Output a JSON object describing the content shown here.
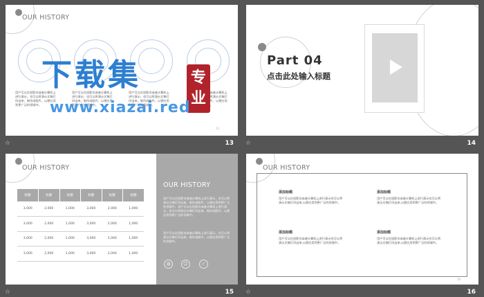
{
  "footer": {
    "star": "☆",
    "numbers": [
      "13",
      "14",
      "15",
      "16"
    ]
  },
  "slide13": {
    "title": "OUR HISTORY",
    "body": "用户可以在投影仪或者计算机上进行演示，也可以将演示文稿打印出来，制作成胶片，以便应用到更广泛的领域中。",
    "page_mini": "13",
    "watermark": {
      "big": "下载集",
      "seal": "专业",
      "url": "www.xiazai.red"
    }
  },
  "slide14": {
    "part": "Part 04",
    "subtitle": "点击此处输入标题"
  },
  "slide15": {
    "title": "OUR HISTORY",
    "table_headers": [
      "标题",
      "标题",
      "标题",
      "标题",
      "标题",
      "标题"
    ],
    "rows": [
      [
        "3,000",
        "2,000",
        "1,000",
        "3,000",
        "2,000",
        "1,000"
      ],
      [
        "3,000",
        "2,000",
        "1,000",
        "3,000",
        "2,000",
        "1,000"
      ],
      [
        "3,000",
        "2,000",
        "1,000",
        "3,000",
        "2,000",
        "1,000"
      ],
      [
        "3,000",
        "2,000",
        "1,000",
        "3,000",
        "2,000",
        "1,000"
      ]
    ],
    "panel_title": "OUR HISTORY",
    "panel_body_1": "用户可以在投影仪或者计算机上进行演示，也可以将演示文稿打印出来，制作成胶片，以便应用到更广泛的领域中。用户可以在投影仪或者计算机上进行演示，也可以将演示文稿打印出来，制作成胶片，以便应用到更广泛的领域中。",
    "panel_body_2": "用户可以在投影仪或者计算机上进行演示，也可以将演示文稿打印出来，制作成胶片，以便应用到更广泛的领域中。",
    "panel_icons": [
      "globe-icon",
      "smile-icon",
      "check-icon"
    ]
  },
  "slide16": {
    "title": "OUR HISTORY",
    "sections": [
      {
        "head": "添加标题",
        "body": "用户可以在投影仪或者计算机上进行演示也可以将演示文稿打印出来,以便应用到更广泛的领域中。"
      },
      {
        "head": "添加标题",
        "body": "用户可以在投影仪或者计算机上进行演示也可以将演示文稿打印出来,以便应用到更广泛的领域中。"
      },
      {
        "head": "添加标题",
        "body": "用户可以在投影仪或者计算机上进行演示也可以将演示文稿打印出来,以便应用到更广泛的领域中。"
      },
      {
        "head": "添加标题",
        "body": "用户可以在投影仪或者计算机上进行演示也可以将演示文稿打印出来,以便应用到更广泛的领域中。"
      }
    ],
    "page_mini": "16"
  }
}
